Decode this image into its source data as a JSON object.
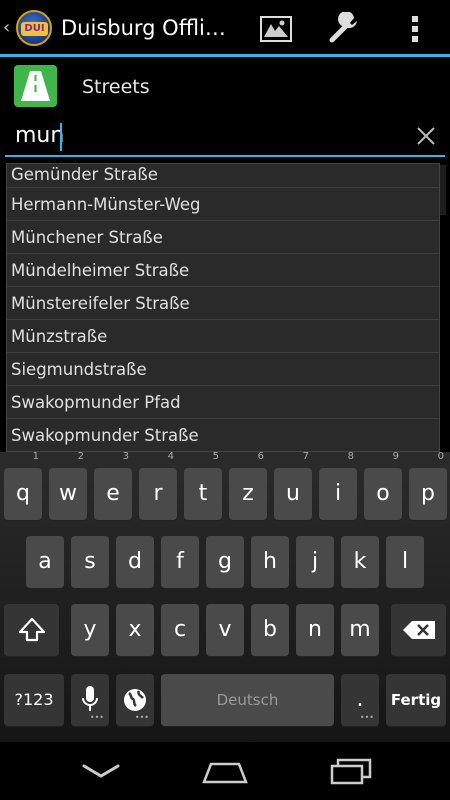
{
  "app": {
    "title": "Duisburg Offlin...",
    "logo_text": "DUI"
  },
  "actionbar": {
    "icons": [
      "map-icon",
      "wrench-icon",
      "overflow-menu-icon"
    ]
  },
  "category": {
    "label": "Streets",
    "icon": "highway-icon"
  },
  "search": {
    "value": "mun"
  },
  "suggestions": [
    "Gemünder Straße",
    "Hermann-Münster-Weg",
    "Münchener Straße",
    "Mündelheimer Straße",
    "Münstereifeler Straße",
    "Münzstraße",
    "Siegmundstraße",
    "Swakopmunder Pfad",
    "Swakopmunder Straße"
  ],
  "keyboard": {
    "row1": [
      {
        "k": "q",
        "h": "1"
      },
      {
        "k": "w",
        "h": "2"
      },
      {
        "k": "e",
        "h": "3"
      },
      {
        "k": "r",
        "h": "4"
      },
      {
        "k": "t",
        "h": "5"
      },
      {
        "k": "z",
        "h": "6"
      },
      {
        "k": "u",
        "h": "7"
      },
      {
        "k": "i",
        "h": "8"
      },
      {
        "k": "o",
        "h": "9"
      },
      {
        "k": "p",
        "h": "0"
      }
    ],
    "row2": [
      "a",
      "s",
      "d",
      "f",
      "g",
      "h",
      "j",
      "k",
      "l"
    ],
    "row3": [
      "y",
      "x",
      "c",
      "v",
      "b",
      "n",
      "m"
    ],
    "numbers_label": "?123",
    "space_label": "Deutsch",
    "period_label": ".",
    "done_label": "Fertig"
  },
  "colors": {
    "accent": "#33b5e5",
    "streets_icon": "#3fb54a"
  }
}
